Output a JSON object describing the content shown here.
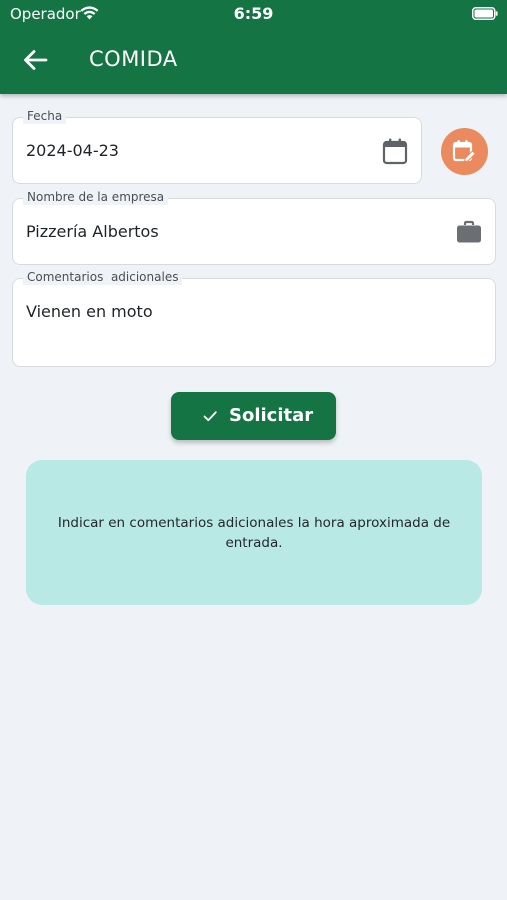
{
  "status_bar": {
    "carrier": "Operador",
    "time": "6:59"
  },
  "header": {
    "title": "COMIDA",
    "back_icon": "arrow-left-icon",
    "background": "#147444"
  },
  "form": {
    "date": {
      "label": "Fecha",
      "value": "2024-04-23",
      "icon": "calendar-icon"
    },
    "company": {
      "label": "Nombre de la empresa",
      "value": "Pizzería Albertos",
      "icon": "briefcase-icon"
    },
    "comments": {
      "label": "Comentarios  adicionales",
      "value": "Vienen en moto"
    },
    "calendar_edit_button": {
      "icon": "calendar-edit-icon",
      "color": "#ea8a5e"
    }
  },
  "submit": {
    "label": "Solicitar",
    "icon": "check-icon"
  },
  "info": {
    "text": "Indicar en comentarios adicionales la hora aproximada de entrada.",
    "background": "#b9e9e4"
  }
}
